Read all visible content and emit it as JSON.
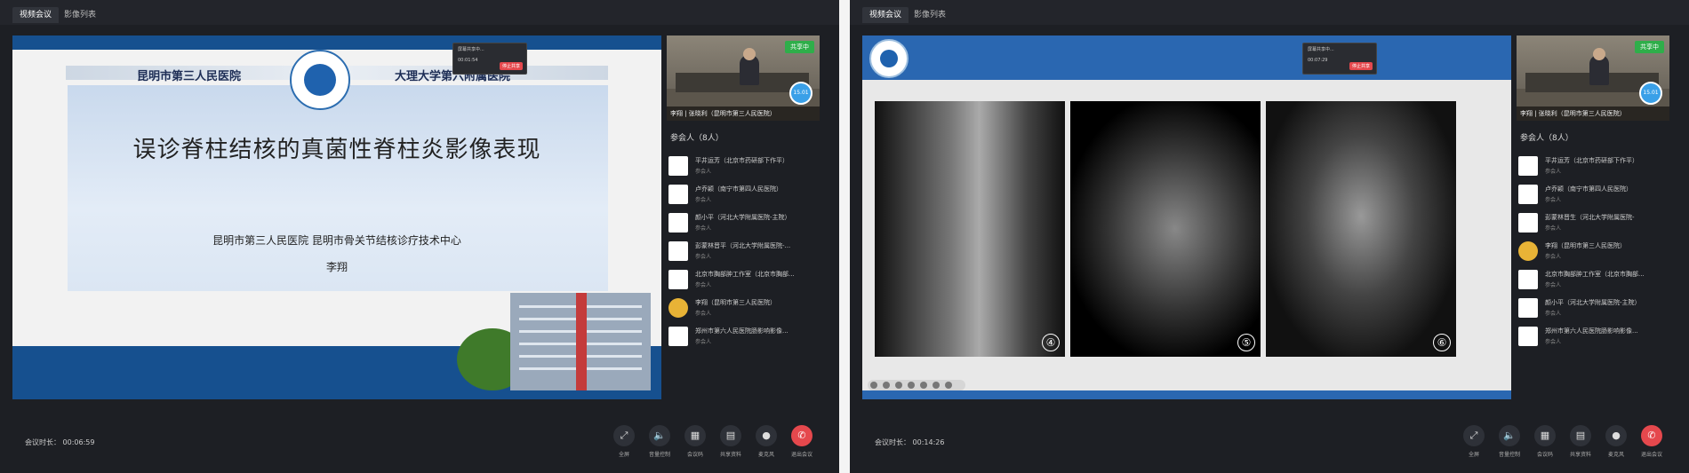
{
  "windows": [
    {
      "tabs": [
        {
          "label": "视频会议",
          "active": true
        },
        {
          "label": "影像列表",
          "active": false
        }
      ],
      "popup": {
        "line1": "屏幕共享中...",
        "line2": "00:01:54",
        "button": "停止共享"
      },
      "slide": {
        "hospital_left": "昆明市第三人民医院",
        "hospital_right": "大理大学第六附属医院",
        "title": "误诊脊柱结核的真菌性脊柱炎影像表现",
        "subtitle": "昆明市第三人民医院  昆明市骨关节结核诊疗技术中心",
        "author": "李翔"
      },
      "video": {
        "badge": "共享中",
        "caption": "李翔 | 张晓利（昆明市第三人民医院）",
        "bubble": "15.01"
      },
      "participants": {
        "count_label": "参会人（8人）",
        "items": [
          {
            "name": "平井运芳（北京市药研部下作平）",
            "role": "参会人"
          },
          {
            "name": "卢乔颖（南宁市第四人民医院）",
            "role": "参会人"
          },
          {
            "name": "颜小平（河北大学附属医院-主院）",
            "role": "参会人"
          },
          {
            "name": "彭蒙林晋平（河北大学附属医院-...",
            "role": "参会人"
          },
          {
            "name": "北京市胸部肿工作室（北京市胸部...",
            "role": "参会人"
          },
          {
            "name": "李翔（昆明市第三人民医院）",
            "role": "参会人"
          },
          {
            "name": "郑州市第六人民医院肠影响影像...",
            "role": "参会人"
          }
        ]
      },
      "duration": "会议时长：  00:06:59"
    },
    {
      "tabs": [
        {
          "label": "视频会议",
          "active": true
        },
        {
          "label": "影像列表",
          "active": false
        }
      ],
      "popup": {
        "line1": "屏幕共享中...",
        "line2": "00:07:29",
        "button": "停止共享"
      },
      "slide": {
        "images": [
          {
            "label": "④"
          },
          {
            "label": "⑤"
          },
          {
            "label": "⑥"
          }
        ]
      },
      "video": {
        "badge": "共享中",
        "caption": "李翔 | 张晓利（昆明市第三人民医院）",
        "bubble": "15.01"
      },
      "participants": {
        "count_label": "参会人（8人）",
        "items": [
          {
            "name": "平井运芳（北京市药研部下作平）",
            "role": "参会人"
          },
          {
            "name": "卢乔颖（南宁市第四人民医院）",
            "role": "参会人"
          },
          {
            "name": "彭蒙林晋生（河北大学附属医院-",
            "role": "参会人"
          },
          {
            "name": "李翔（昆明市第三人民医院）",
            "role": "参会人"
          },
          {
            "name": "北京市胸部肿工作室（北京市胸部...",
            "role": "参会人"
          },
          {
            "name": "颜小平（河北大学附属医院-主院）",
            "role": "参会人"
          },
          {
            "name": "郑州市第六人民医院肠影响影像...",
            "role": "参会人"
          }
        ]
      },
      "duration": "会议时长：  00:14:26"
    }
  ],
  "controls": [
    {
      "label": "全屏",
      "icon": "fullscreen-icon"
    },
    {
      "label": "音量控制",
      "icon": "volume-icon"
    },
    {
      "label": "会议码",
      "icon": "qrcode-icon"
    },
    {
      "label": "共享资料",
      "icon": "document-icon"
    },
    {
      "label": "麦克风",
      "icon": "microphone-icon"
    },
    {
      "label": "退出会议",
      "icon": "hangup-icon"
    }
  ],
  "colors": {
    "background": "#1d1f24",
    "accent_blue": "#16508f",
    "share_badge": "#2fae4a",
    "hangup": "#e5484d"
  }
}
